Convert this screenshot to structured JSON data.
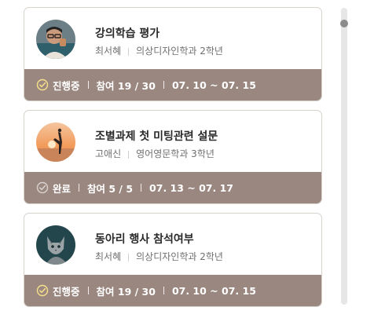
{
  "cards": [
    {
      "title": "강의학습 평가",
      "author": "최서혜",
      "dept": "의상디자인학과 2학년",
      "status": "진행중",
      "participation": "참여 19 / 30",
      "period": "07. 10 ~ 07. 15",
      "status_icon": "check-circle-icon",
      "status_color": "#f7e08a"
    },
    {
      "title": "조별과제 첫 미팅관련 설문",
      "author": "고애신",
      "dept": "영어영문학과 3학년",
      "status": "완료",
      "participation": "참여 5 / 5",
      "period": "07. 13 ~ 07. 17",
      "status_icon": "check-circle-icon",
      "status_color": "#d9d2ce"
    },
    {
      "title": "동아리 행사 참석여부",
      "author": "최서혜",
      "dept": "의상디자인학과 2학년",
      "status": "진행중",
      "participation": "참여 19 / 30",
      "period": "07. 10 ~ 07. 15",
      "status_icon": "check-circle-icon",
      "status_color": "#f7e08a"
    }
  ],
  "colors": {
    "footer_bg": "#9a8780",
    "border": "#d8d2cd"
  }
}
